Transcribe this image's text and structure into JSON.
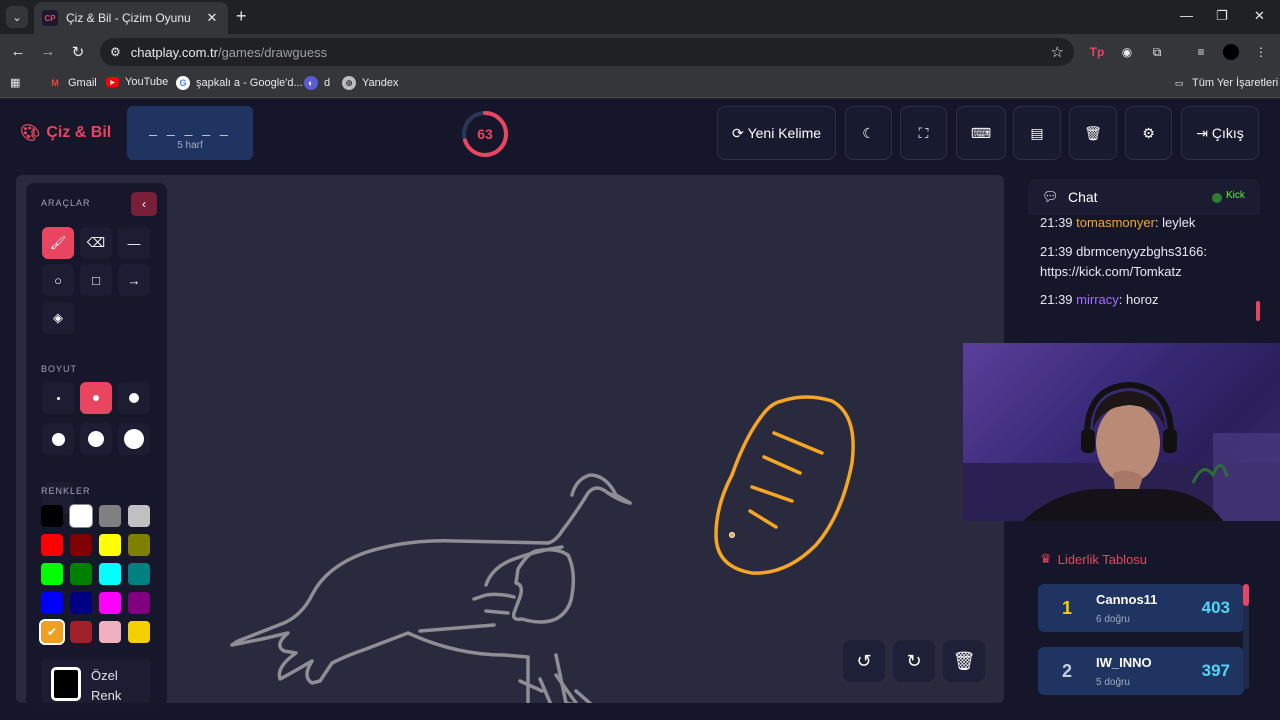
{
  "browser": {
    "tab_title": "Çiz & Bil - Çizim Oyunu",
    "favicon_text": "CP",
    "url_host": "chatplay.com.tr",
    "url_path": "/games/drawguess",
    "bookmarks": [
      "Gmail",
      "YouTube",
      "şapkalı a - Google'd...",
      "d",
      "Yandex"
    ],
    "all_bookmarks": "Tüm Yer İşaretleri"
  },
  "header": {
    "logo": "Çiz & Bil",
    "word_mask": "_ _ _ _ _",
    "word_length": "5 harf",
    "timer": "63",
    "timer_fraction": 0.7,
    "new_word": "Yeni Kelime",
    "exit": "Çıkış"
  },
  "tools": {
    "tools_title": "ARAÇLAR",
    "size_title": "BOYUT",
    "colors_title": "RENKLER",
    "custom_color_line1": "Özel",
    "custom_color_line2": "Renk",
    "colors": [
      "#000000",
      "#ffffff",
      "#808080",
      "#c0c0c0",
      "#ff0000",
      "#800000",
      "#ffff00",
      "#808000",
      "#00ff00",
      "#008000",
      "#00ffff",
      "#008080",
      "#0000ff",
      "#000080",
      "#ff00ff",
      "#800080",
      "#f0a020",
      "#a0202a",
      "#f0b0c0",
      "#f5d000"
    ]
  },
  "chat": {
    "title": "Chat",
    "status": "Kick",
    "messages": [
      {
        "time": "21:39",
        "user": "tomasmonyer",
        "text": ": leylek",
        "color": "#f0a33c"
      },
      {
        "time": "21:39",
        "user": "dbrmcenyyzbghs3166",
        "text": ": https://kick.com/Tomkatz",
        "color": "#e8e8f0"
      },
      {
        "time": "21:39",
        "user": "mirracy",
        "text": ": horoz",
        "color": "#a46cff"
      }
    ]
  },
  "leaderboard": {
    "title": "Liderlik Tablosu",
    "rows": [
      {
        "rank": "1",
        "name": "Cannos11",
        "sub": "6 doğru",
        "score": "403",
        "rank_color": "#f5d000"
      },
      {
        "rank": "2",
        "name": "IW_INNO",
        "sub": "5 doğru",
        "score": "397",
        "rank_color": "#c8d0e0"
      }
    ]
  },
  "colors": {
    "accent": "#e94560",
    "word_box": "#1f3460",
    "score": "#4fd6f7"
  }
}
